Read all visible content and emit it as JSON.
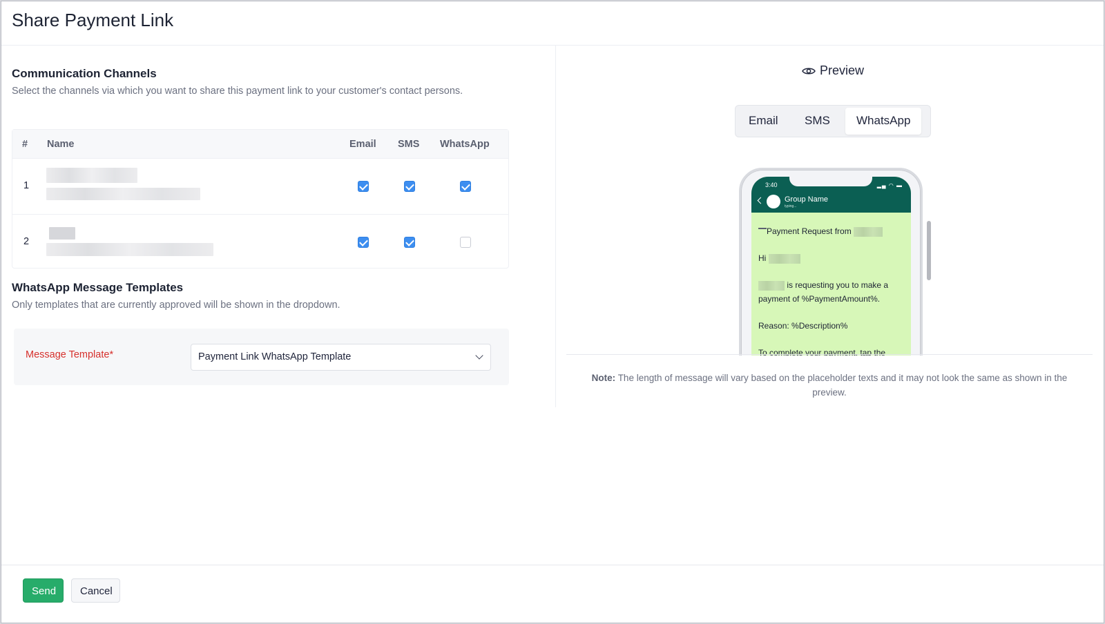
{
  "header": {
    "title": "Share Payment Link"
  },
  "channels": {
    "title": "Communication Channels",
    "description": "Select the channels via which you want to share this payment link to your customer's contact persons.",
    "columns": {
      "num": "#",
      "name": "Name",
      "email": "Email",
      "sms": "SMS",
      "whatsapp": "WhatsApp"
    },
    "rows": [
      {
        "num": "1",
        "email": true,
        "sms": true,
        "whatsapp": true
      },
      {
        "num": "2",
        "email": true,
        "sms": true,
        "whatsapp": false
      }
    ]
  },
  "templates": {
    "title": "WhatsApp Message Templates",
    "description": "Only templates that are currently approved will be shown in the dropdown.",
    "label": "Message Template*",
    "selected": "Payment Link WhatsApp Template"
  },
  "preview": {
    "title": "Preview",
    "tabs": [
      "Email",
      "SMS",
      "WhatsApp"
    ],
    "active_tab": "WhatsApp",
    "phone": {
      "time": "3:40",
      "group_name": "Group Name",
      "typing": "typing...",
      "lines": {
        "l1": "Payment Request from",
        "l2": "Hi",
        "l3a": "is requesting you to make a",
        "l3b": "payment of %PaymentAmount%.",
        "l4": "Reason: %Description%",
        "l5": "To complete your payment, tap the"
      }
    },
    "note_label": "Note:",
    "note_text": "The length of message will vary based on the placeholder texts and it may not look the same as shown in the preview."
  },
  "footer": {
    "send": "Send",
    "cancel": "Cancel"
  },
  "colors": {
    "primary_button": "#27ac6a",
    "checkbox": "#3d8ef0",
    "required_label": "#d6302c",
    "whatsapp_header": "#0b5f53",
    "whatsapp_bubble": "#d7f7b8"
  }
}
